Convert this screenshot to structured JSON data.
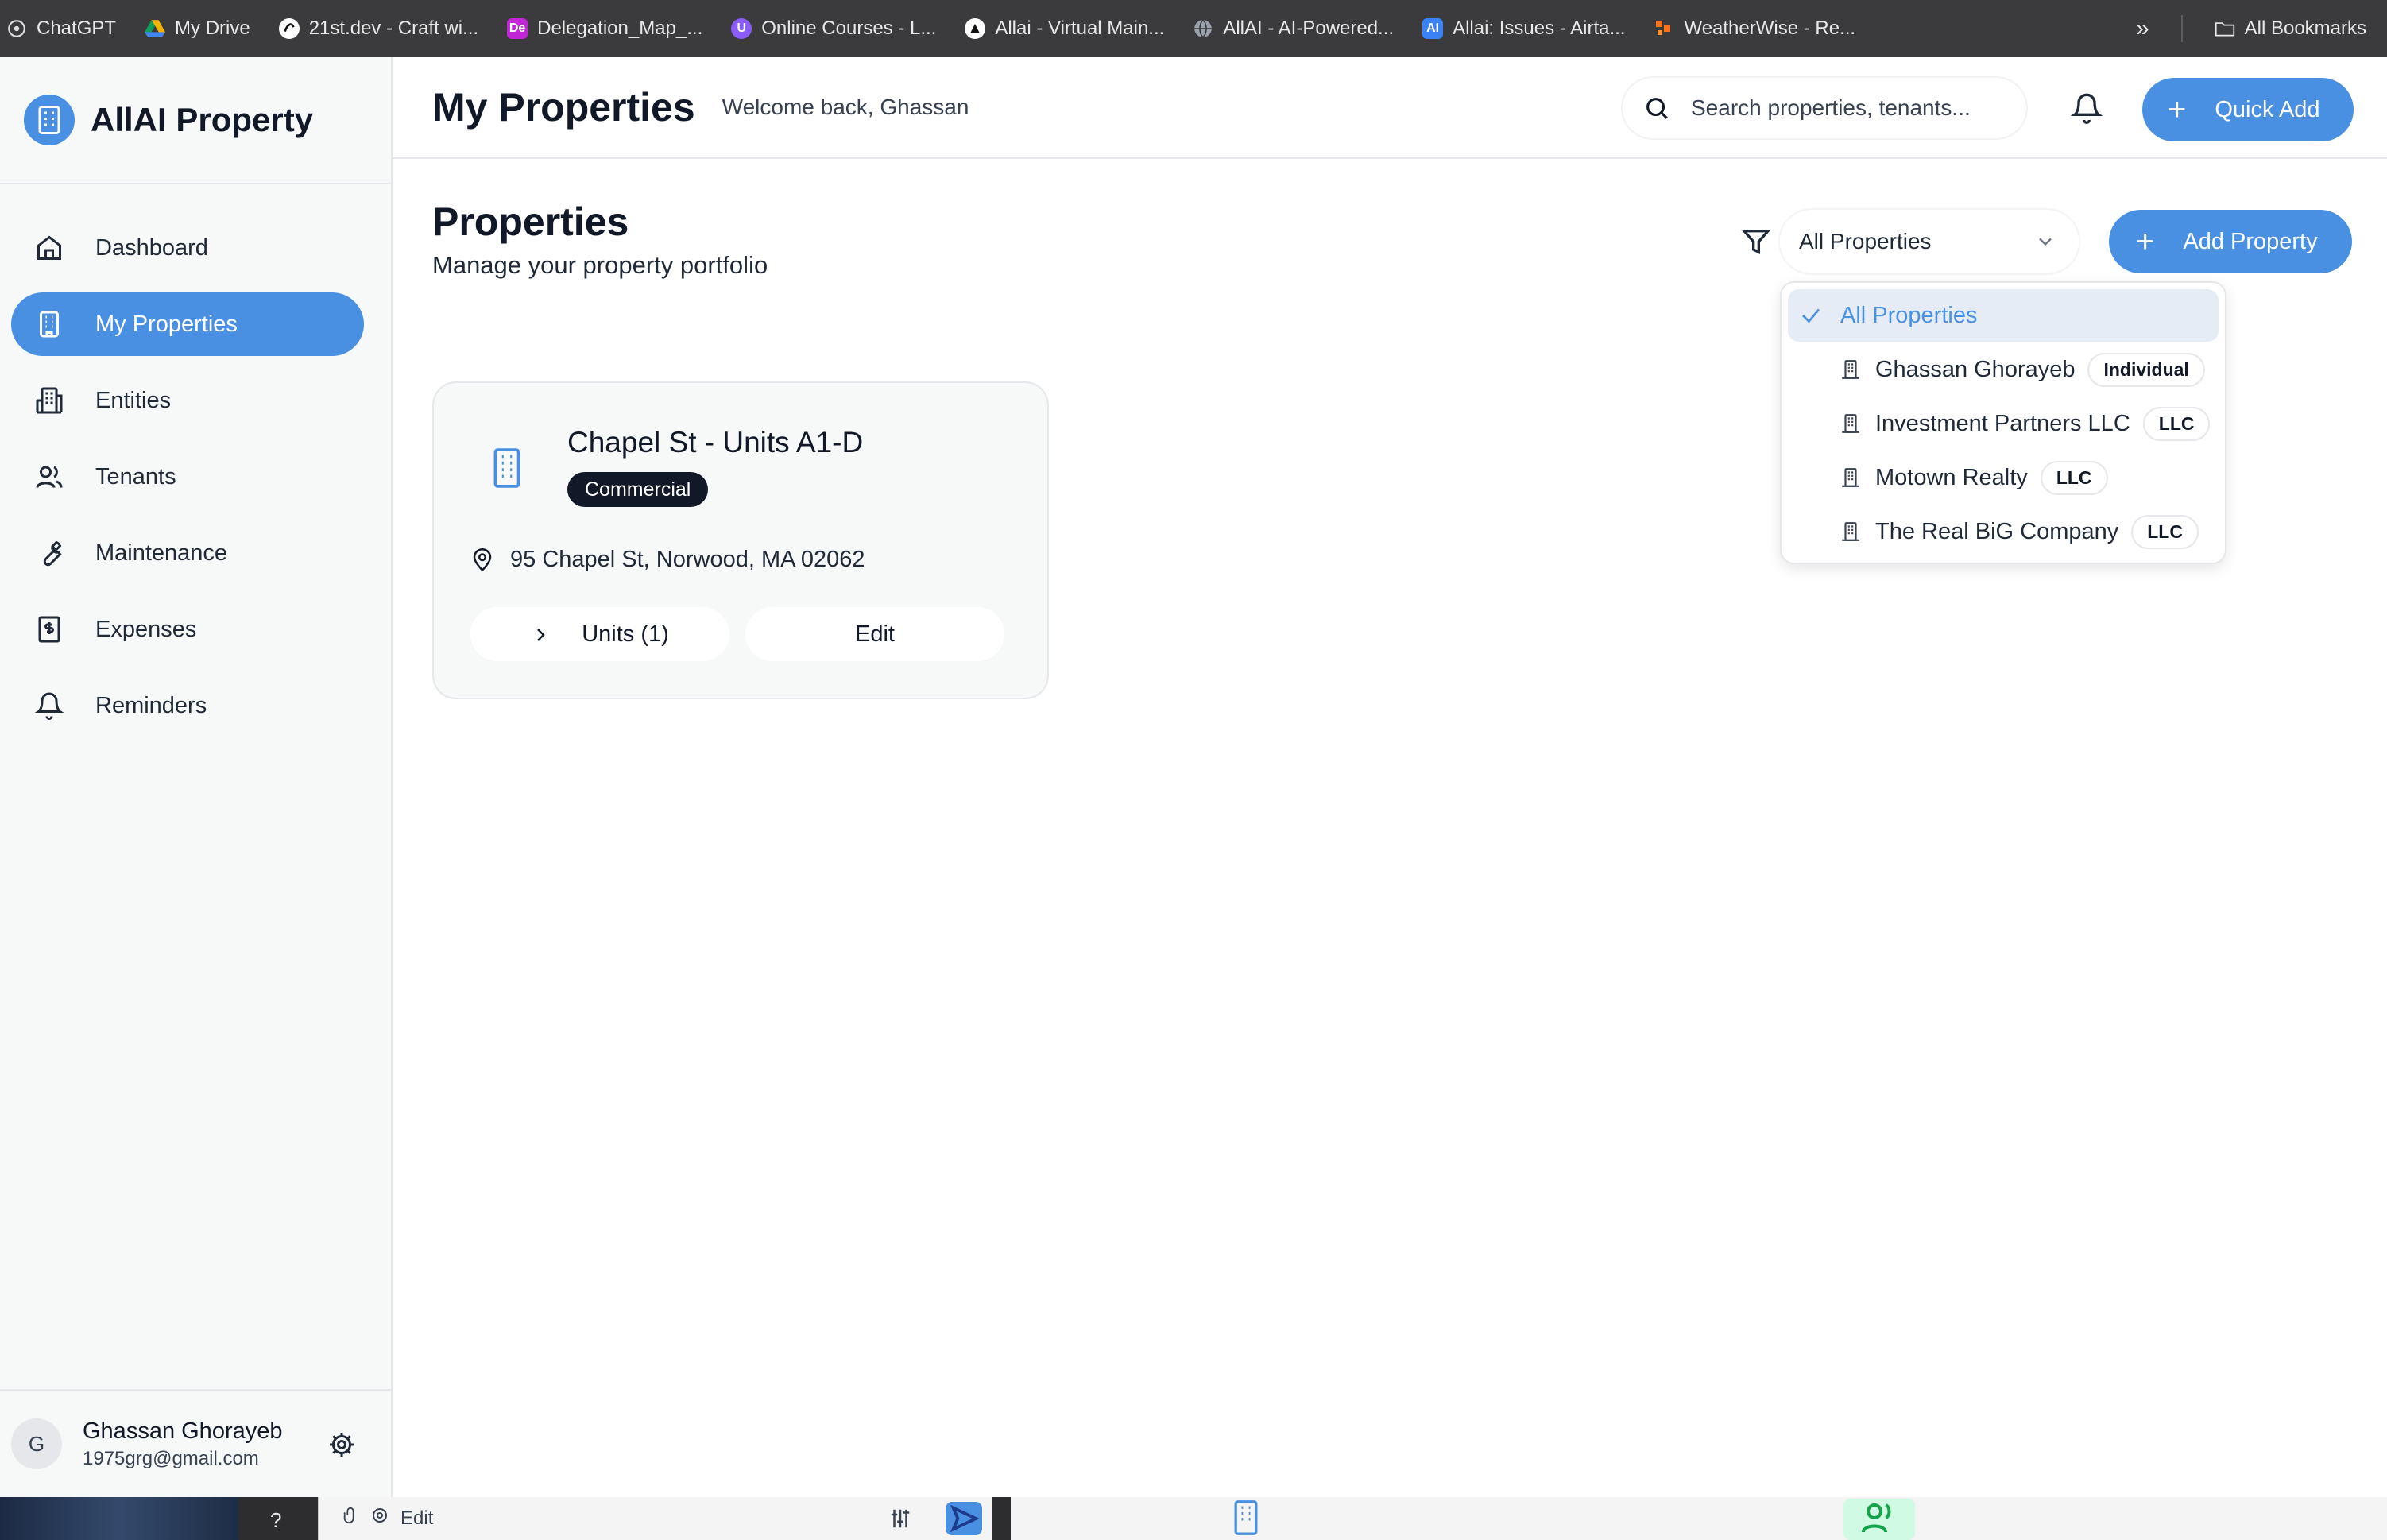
{
  "bookmarks": {
    "items": [
      {
        "label": "ChatGPT",
        "icon": "chatgpt-icon",
        "color": "#2b2b2b"
      },
      {
        "label": "My Drive",
        "icon": "drive-icon",
        "color": "#f4b400"
      },
      {
        "label": "21st.dev - Craft wi...",
        "icon": "21st-icon",
        "color": "#ffffff"
      },
      {
        "label": "Delegation_Map_...",
        "icon": "de-icon",
        "color": "#c026d3"
      },
      {
        "label": "Online Courses - L...",
        "icon": "udemy-icon",
        "color": "#8b5cf6"
      },
      {
        "label": "Allai - Virtual Main...",
        "icon": "allai-icon",
        "color": "#111111"
      },
      {
        "label": "AllAI - AI-Powered...",
        "icon": "globe-icon",
        "color": "#9ca3af"
      },
      {
        "label": "Allai: Issues - Airta...",
        "icon": "ai-icon",
        "color": "#3b82f6"
      },
      {
        "label": "WeatherWise - Re...",
        "icon": "weather-icon",
        "color": "#f97316"
      }
    ],
    "all_bookmarks": "All Bookmarks"
  },
  "sidebar": {
    "brand": "AllAI Property",
    "items": [
      {
        "label": "Dashboard",
        "icon": "home-icon"
      },
      {
        "label": "My Properties",
        "icon": "building-icon",
        "active": true
      },
      {
        "label": "Entities",
        "icon": "entities-icon"
      },
      {
        "label": "Tenants",
        "icon": "users-icon"
      },
      {
        "label": "Maintenance",
        "icon": "wrench-icon"
      },
      {
        "label": "Expenses",
        "icon": "receipt-icon"
      },
      {
        "label": "Reminders",
        "icon": "bell-icon"
      }
    ],
    "user": {
      "initial": "G",
      "name": "Ghassan Ghorayeb",
      "email": "1975grg@gmail.com"
    }
  },
  "header": {
    "title": "My Properties",
    "welcome": "Welcome back, Ghassan",
    "search_placeholder": "Search properties, tenants...",
    "quick_add": "Quick Add"
  },
  "main": {
    "title": "Properties",
    "subtitle": "Manage your property portfolio",
    "filter": {
      "selected": "All Properties",
      "options": [
        {
          "label": "All Properties",
          "selected": true
        },
        {
          "label": "Ghassan Ghorayeb",
          "badge": "Individual"
        },
        {
          "label": "Investment Partners LLC",
          "badge": "LLC"
        },
        {
          "label": "Motown Realty",
          "badge": "LLC"
        },
        {
          "label": "The Real BiG Company",
          "badge": "LLC"
        }
      ]
    },
    "add_property": "Add Property",
    "properties": [
      {
        "name": "Chapel St - Units A1-D",
        "type": "Commercial",
        "address": "95 Chapel St, Norwood, MA 02062",
        "units_label": "Units (1)",
        "edit_label": "Edit"
      }
    ]
  },
  "taskbar": {
    "edit": "Edit",
    "help": "?"
  },
  "colors": {
    "accent": "#4a90e2",
    "badge_dark": "#111827",
    "sidebar_bg": "#f7f8f8"
  }
}
